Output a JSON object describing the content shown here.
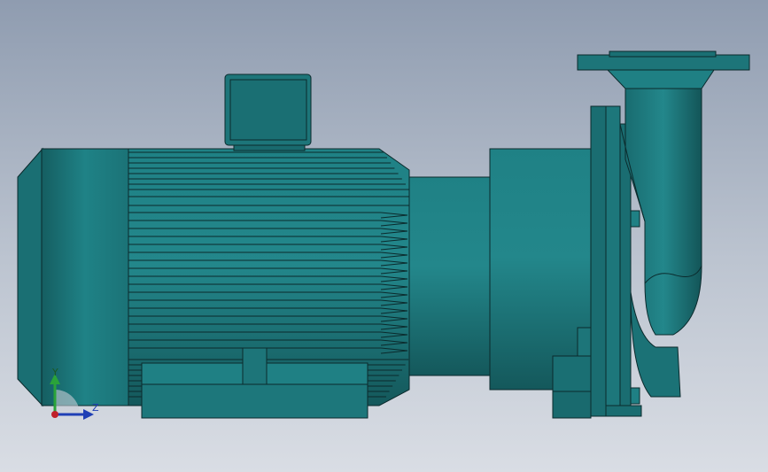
{
  "viewport": {
    "background_top": "#8f9cb0",
    "background_bottom": "#d9dde4"
  },
  "model": {
    "body_color": "#1d7579",
    "light_color": "#23868a",
    "dark_color": "#0f4f52",
    "edge_color": "#0b2a2c",
    "parts": [
      "motor-fan-cover",
      "motor-housing",
      "terminal-box",
      "motor-foot",
      "coupling-shaft",
      "bearing-housing",
      "pump-casing",
      "discharge-pipe",
      "discharge-flange"
    ]
  },
  "triad": {
    "y_label": "Y",
    "z_label": "Z",
    "y_color": "#2aa33a",
    "z_color": "#1f3fb5",
    "origin_color": "#c0202a"
  }
}
